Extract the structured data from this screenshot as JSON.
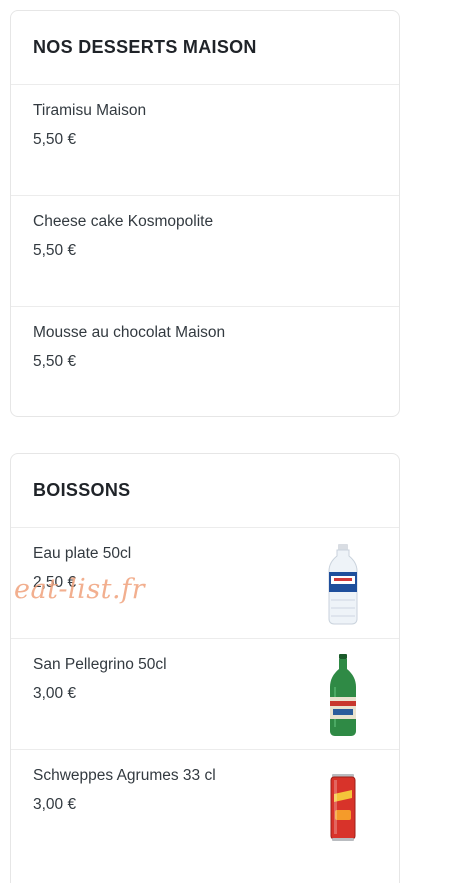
{
  "desserts": {
    "title": "NOS DESSERTS MAISON",
    "items": [
      {
        "name": "Tiramisu Maison",
        "price": "5,50 €"
      },
      {
        "name": "Cheese cake Kosmopolite",
        "price": "5,50 €"
      },
      {
        "name": "Mousse au chocolat Maison",
        "price": "5,50 €"
      }
    ]
  },
  "drinks": {
    "title": "BOISSONS",
    "items": [
      {
        "name": "Eau plate 50cl",
        "price": "2,50 €",
        "image": "water-bottle-icon"
      },
      {
        "name": "San Pellegrino 50cl",
        "price": "3,00 €",
        "image": "green-bottle-icon"
      },
      {
        "name": "Schweppes Agrumes 33 cl",
        "price": "3,00 €",
        "image": "soda-can-icon"
      }
    ]
  },
  "watermark": "eat-list.fr",
  "colors": {
    "border": "#e6e6e6",
    "text": "#333a40",
    "watermark": "#f0a27c"
  }
}
